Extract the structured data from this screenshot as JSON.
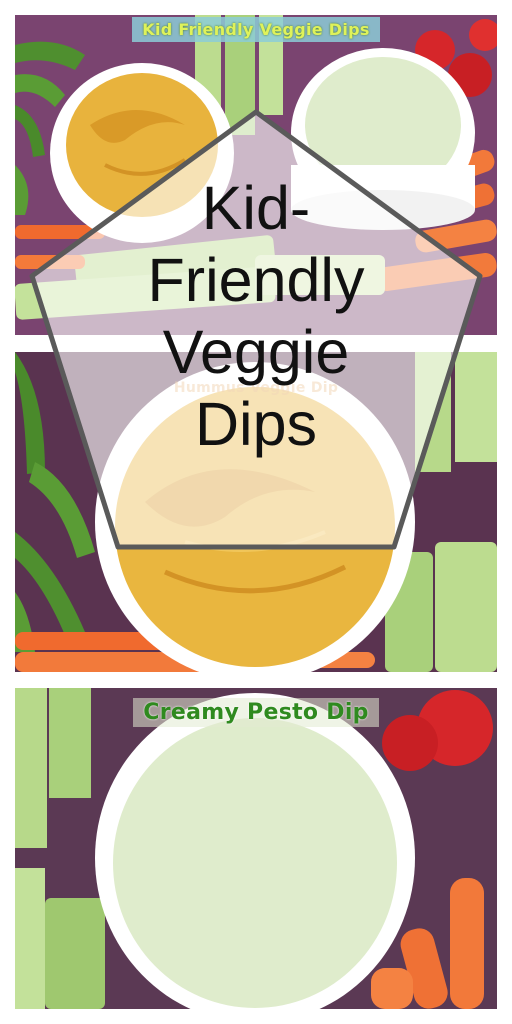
{
  "title_lines": [
    "Kid-",
    "Friendly",
    "Veggie",
    "Dips"
  ],
  "panels": [
    {
      "label": "Kid Friendly Veggie Dips"
    },
    {
      "label": "Hummus Veggie Dip"
    },
    {
      "label": "Creamy Pesto Dip"
    }
  ],
  "colors": {
    "hummus": "#e8b33d",
    "pesto_dip": "#dfeccc",
    "celery": "#b7d98a",
    "carrot": "#f2793a",
    "snap_pea": "#4f8f2f",
    "tomato": "#d6262a",
    "tray": "#6b3a5e"
  }
}
